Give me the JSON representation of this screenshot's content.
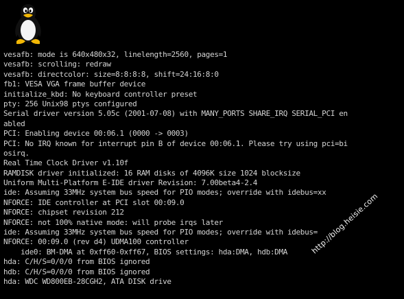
{
  "screen": {
    "background": "#000000",
    "text_color": "#d4d4d4"
  },
  "logo": {
    "icon": "tux-penguin-icon"
  },
  "console_lines": [
    "vesafb: mode is 640x480x32, linelength=2560, pages=1",
    "vesafb: scrolling: redraw",
    "vesafb: directcolor: size=8:8:8:8, shift=24:16:8:0",
    "fb1: VESA VGA frame buffer device",
    "initialize_kbd: No keyboard controller preset",
    "pty: 256 Unix98 ptys configured",
    "Serial driver version 5.05c (2001-07-08) with MANY_PORTS SHARE_IRQ SERIAL_PCI en",
    "abled",
    "PCI: Enabling device 00:06.1 (0000 -> 0003)",
    "PCI: No IRQ known for interrupt pin B of device 00:06.1. Please try using pci=bi",
    "osirq.",
    "Real Time Clock Driver v1.10f",
    "RAMDISK driver initialized: 16 RAM disks of 4096K size 1024 blocksize",
    "Uniform Multi-Platform E-IDE driver Revision: 7.00beta4-2.4",
    "ide: Assuming 33MHz system bus speed for PIO modes; override with idebus=xx",
    "NFORCE: IDE controller at PCI slot 00:09.0",
    "NFORCE: chipset revision 212",
    "NFORCE: not 100% native mode: will probe irqs later",
    "ide: Assuming 33MHz system bus speed for PIO modes; override with idebus=",
    "NFORCE: 00:09.0 (rev d4) UDMA100 controller",
    "    ide0: BM-DMA at 0xff60-0xff67, BIOS settings: hda:DMA, hdb:DMA",
    "hda: C/H/S=0/0/0 from BIOS ignored",
    "hdb: C/H/S=0/0/0 from BIOS ignored",
    "hda: WDC WD800EB-28CGH2, ATA DISK drive"
  ],
  "watermark": {
    "text": "http://blog.heisie.com"
  }
}
